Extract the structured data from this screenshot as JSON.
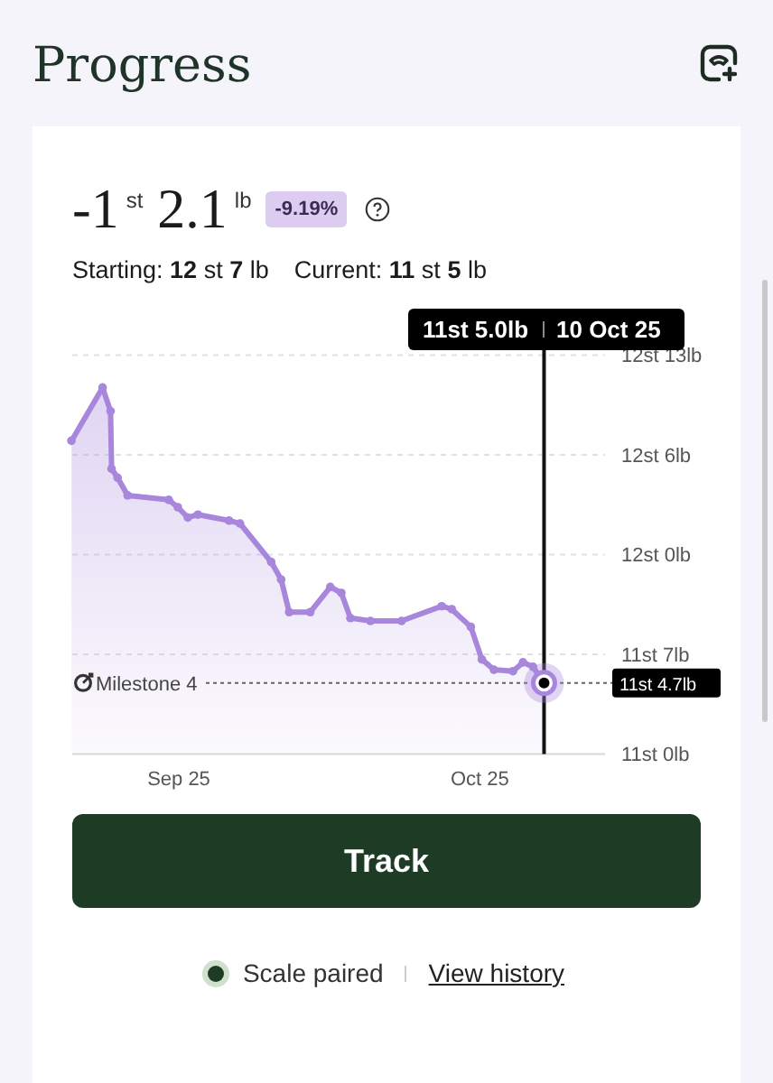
{
  "header": {
    "title": "Progress"
  },
  "summary": {
    "change_st": "-1",
    "st_unit": "st",
    "change_lb": "2.1",
    "lb_unit": "lb",
    "percent": "-9.19%",
    "starting": "Starting: **12** st **7** lb",
    "current": "Current: **11** st **5** lb"
  },
  "chart": {
    "y_labels": [
      "12st 13lb",
      "12st 6lb",
      "12st 0lb",
      "11st 7lb",
      "11st 0lb"
    ],
    "x_labels": [
      "Sep 25",
      "Oct 25"
    ],
    "milestone": "Milestone 4",
    "milestone_value": "11st 4.7lb",
    "tooltip_weight": "11st 5.0lb",
    "tooltip_date": "10 Oct 25"
  },
  "track_button": "Track",
  "footer": {
    "status": "Scale paired",
    "link": "View history"
  }
}
